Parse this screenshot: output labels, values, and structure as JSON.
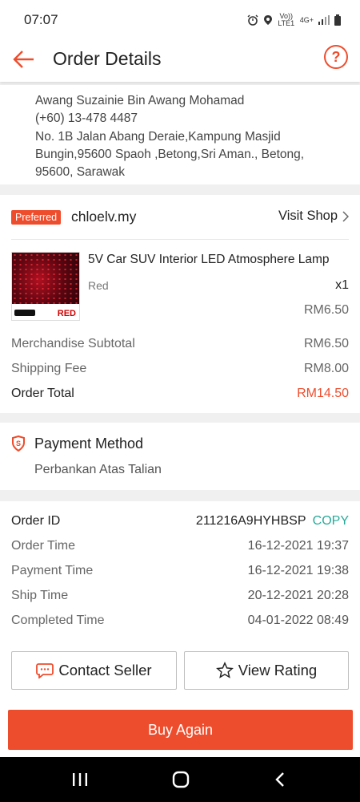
{
  "status_bar": {
    "time": "07:07",
    "icons": [
      "alarm-icon",
      "location-icon",
      "volte-icon",
      "4g-icon",
      "signal-icon",
      "battery-icon"
    ],
    "volte_text": "Vo)) LTE1",
    "network_text": "4G+"
  },
  "header": {
    "title": "Order Details",
    "back_icon": "arrow-left-icon",
    "help_icon": "question-circle-icon",
    "help_symbol": "?"
  },
  "address": {
    "name": "Awang Suzainie Bin Awang Mohamad",
    "phone": "(+60) 13-478 4487",
    "line1": "No. 1B Jalan Abang Deraie,Kampung Masjid",
    "line2": "Bungin,95600 Spaoh ,Betong,Sri Aman., Betong,",
    "line3": "95600, Sarawak"
  },
  "shop": {
    "badge": "Preferred",
    "name": "chloelv.my",
    "visit_label": "Visit Shop"
  },
  "product": {
    "name": "5V Car SUV Interior LED Atmosphere Lamp",
    "variation": "Red",
    "quantity": "x1",
    "price": "RM6.50",
    "thumb_label": "RED"
  },
  "summary": {
    "subtotal_label": "Merchandise Subtotal",
    "subtotal_value": "RM6.50",
    "shipping_label": "Shipping Fee",
    "shipping_value": "RM8.00",
    "total_label": "Order Total",
    "total_value": "RM14.50"
  },
  "payment": {
    "title": "Payment Method",
    "value": "Perbankan Atas Talian"
  },
  "order_info": {
    "order_id_label": "Order ID",
    "order_id": "211216A9HYHBSP",
    "copy_label": "COPY",
    "rows": [
      {
        "label": "Order Time",
        "value": "16-12-2021 19:37"
      },
      {
        "label": "Payment Time",
        "value": "16-12-2021 19:38"
      },
      {
        "label": "Ship Time",
        "value": "20-12-2021 20:28"
      },
      {
        "label": "Completed Time",
        "value": "04-01-2022 08:49"
      }
    ]
  },
  "actions": {
    "contact_seller": "Contact Seller",
    "view_rating": "View Rating",
    "buy_again": "Buy Again"
  },
  "colors": {
    "accent": "#ee4d2d",
    "copy": "#26aa99"
  }
}
